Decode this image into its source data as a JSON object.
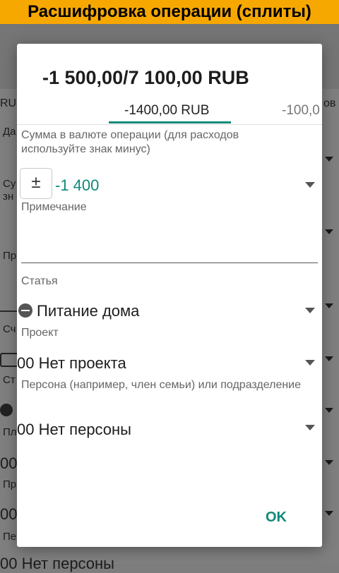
{
  "app_title": "Расшифровка операции (сплиты)",
  "background": {
    "tab_left": "RU",
    "tab_right": "ов",
    "labels": [
      "Да",
      "Су",
      "зн",
      "Пр",
      "Сч",
      "Ст",
      "Пл",
      "Пр",
      "Пе"
    ],
    "values": [
      "00",
      "00",
      "00 Нет персоны"
    ]
  },
  "dialog": {
    "title": "-1 500,00/7 100,00 RUB",
    "tabs": [
      {
        "label": "-1400,00 RUB",
        "active": true
      },
      {
        "label": "-100,0",
        "active": false
      }
    ],
    "amount_label": "Сумма в валюте операции (для расходов используйте знак минус)",
    "sign_button": "±",
    "amount_value": "-1 400",
    "note_label": "Примечание",
    "note_value": "",
    "category_label": "Статья",
    "category_value": "Питание дома",
    "project_label": "Проект",
    "project_value": "00 Нет проекта",
    "person_label": "Персона (например, член семьи) или подразделение",
    "person_value": "00 Нет персоны",
    "ok_label": "OK"
  },
  "colors": {
    "title_bar": "#f7a800",
    "accent": "#10897a"
  }
}
